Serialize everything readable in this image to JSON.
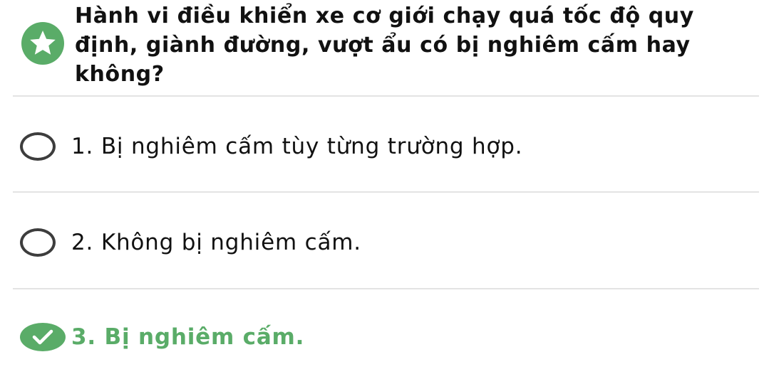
{
  "colors": {
    "accent": "#5aac68",
    "text": "#111111",
    "divider": "#e3e3e3"
  },
  "question": {
    "icon": "star-icon",
    "text": "Hành vi điều khiển xe cơ giới chạy quá tốc độ quy định, giành đường, vượt ẩu có bị nghiêm cấm hay không?"
  },
  "options": [
    {
      "label": "1. Bị nghiêm cấm tùy từng trường hợp.",
      "state": "unselected"
    },
    {
      "label": "2. Không bị nghiêm cấm.",
      "state": "unselected"
    },
    {
      "label": "3. Bị nghiêm cấm.",
      "state": "correct",
      "icon": "check-icon"
    }
  ]
}
